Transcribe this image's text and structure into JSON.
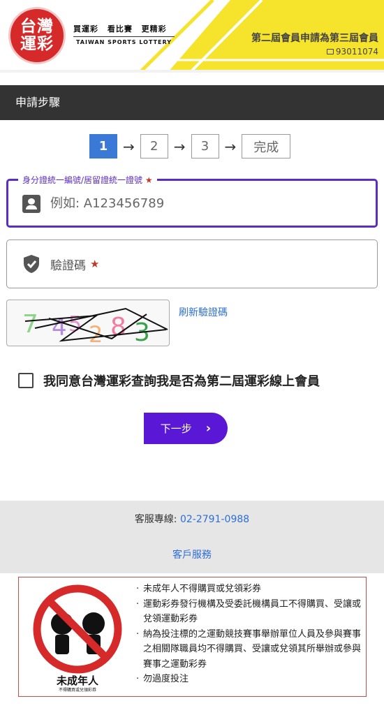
{
  "header": {
    "logo_line1": "台灣",
    "logo_line2": "運彩",
    "slogan": "買運彩 看比賽 更精彩",
    "slogan_en": "TAIWAN SPORTS LOTTERY",
    "notice": "第二屆會員申請為第三屆會員",
    "code": "93011074"
  },
  "titlebar": {
    "title": "申請步驟"
  },
  "steps": {
    "items": [
      "1",
      "2",
      "3",
      "完成"
    ],
    "arrow": "→",
    "active_index": 0
  },
  "form": {
    "id_label": "身分證統一編號/居留證統一證號",
    "id_placeholder": "例如: A123456789",
    "required_mark": "★",
    "captcha_label": "驗證碼",
    "captcha_chars": [
      "7",
      "4",
      "5",
      "2",
      "8",
      "3"
    ],
    "refresh_label": "刷新驗證碼",
    "agree_text": "我同意台灣運彩查詢我是否為第二屆運彩線上會員",
    "next_label": "下一步",
    "next_chevron": "›"
  },
  "footer": {
    "phone_label": "客服專線: ",
    "phone_number": "02-2791-0988",
    "service_label": "客戶服務"
  },
  "warning": {
    "caption": "未成年人",
    "sub_caption": "不得購買或兌領彩券",
    "rules": [
      "未成年人不得購買或兌領彩券",
      "運動彩券發行機構及受委託機構員工不得購買、受讓或兌領運動彩券",
      "納為投注標的之運動競技賽事舉辦單位人員及參與賽事之相關隊職員均不得購買、受讓或兌領其所舉辦或參與賽事之運動彩券",
      "勿過度投注"
    ]
  },
  "colors": {
    "brand_red": "#d62a2a",
    "accent_purple": "#5a18d6",
    "step_blue": "#3a79d6",
    "link_blue": "#2d6fd6",
    "header_yellow": "#f6e32b"
  }
}
